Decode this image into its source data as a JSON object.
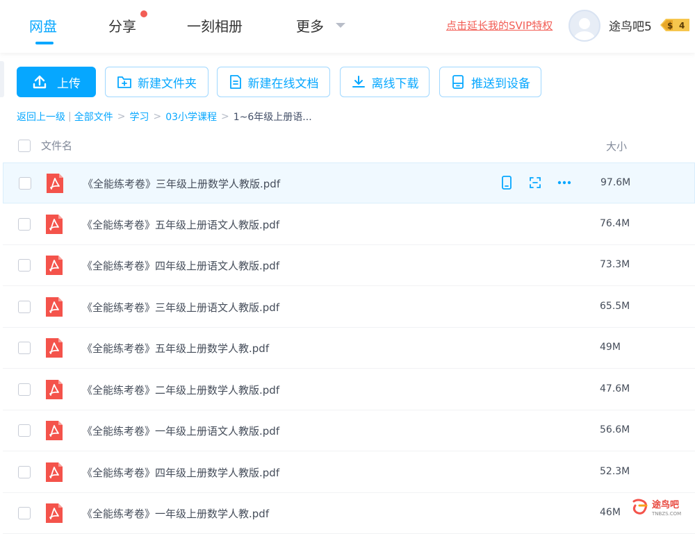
{
  "nav": {
    "tabs": [
      {
        "label": "网盘",
        "active": true
      },
      {
        "label": "分享",
        "has_dot": true
      },
      {
        "label": "一刻相册"
      },
      {
        "label": "更多",
        "has_dropdown": true
      }
    ],
    "svip_link": "点击延长我的SVIP特权",
    "username": "途鸟吧5",
    "vip_level": "4",
    "vip_symbol": "$"
  },
  "toolbar": {
    "upload": "上传",
    "new_folder": "新建文件夹",
    "new_doc": "新建在线文档",
    "offline_download": "离线下载",
    "push_device": "推送到设备"
  },
  "breadcrumb": {
    "back": "返回上一级",
    "divider": "|",
    "sep": ">",
    "items": [
      "全部文件",
      "学习",
      "03小学课程"
    ],
    "current": "1~6年级上册语..."
  },
  "table": {
    "col_name": "文件名",
    "col_size": "大小",
    "rows": [
      {
        "name": "《全能练考卷》三年级上册数学人教版.pdf",
        "size": "97.6M"
      },
      {
        "name": "《全能练考卷》五年级上册语文人教版.pdf",
        "size": "76.4M"
      },
      {
        "name": "《全能练考卷》四年级上册语文人教版.pdf",
        "size": "73.3M"
      },
      {
        "name": "《全能练考卷》三年级上册语文人教版.pdf",
        "size": "65.5M"
      },
      {
        "name": "《全能练考卷》五年级上册数学人教.pdf",
        "size": "49M"
      },
      {
        "name": "《全能练考卷》二年级上册数学人教版.pdf",
        "size": "47.6M"
      },
      {
        "name": "《全能练考卷》一年级上册语文人教版.pdf",
        "size": "56.6M"
      },
      {
        "name": "《全能练考卷》四年级上册数学人教版.pdf",
        "size": "52.3M"
      },
      {
        "name": "《全能练考卷》一年级上册数学人教.pdf",
        "size": "46M"
      }
    ],
    "hovered_row": 0
  },
  "watermark": {
    "text": "途鸟吧",
    "sub": "TNBZS.COM"
  },
  "colors": {
    "accent": "#06a7ff",
    "pdf_red": "#f4534b",
    "link_red": "#f25d55"
  }
}
